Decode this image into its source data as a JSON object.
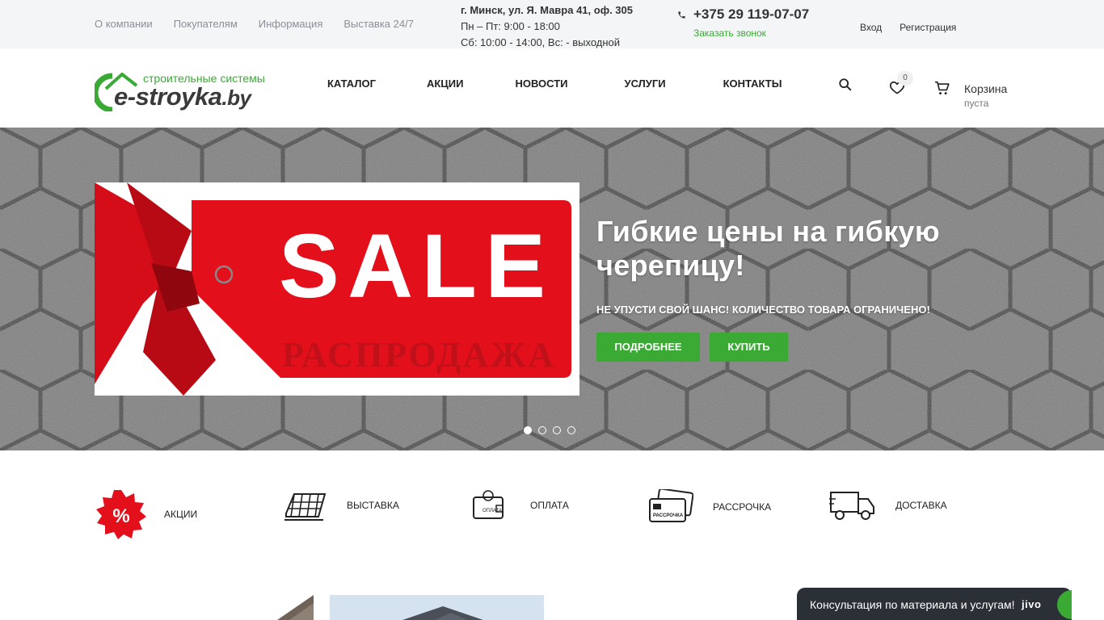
{
  "topbar": {
    "links": [
      "О компании",
      "Покупателям",
      "Информация",
      "Выставка 24/7"
    ],
    "address": "г. Минск, ул. Я. Мавра 41, оф. 305",
    "hours_weekdays": "Пн – Пт: 9:00 - 18:00",
    "hours_weekend": "Сб: 10:00 - 14:00,  Вс: - выходной",
    "phone": "+375 29 119-07-07",
    "callback": "Заказать звонок",
    "login": "Вход",
    "register": "Регистрация"
  },
  "header": {
    "logo_slogan": "строительные системы",
    "logo_brand": "e-stroyka",
    "logo_tld": ".by",
    "nav": [
      "КАТАЛОГ",
      "АКЦИИ",
      "НОВОСТИ",
      "УСЛУГИ",
      "КОНТАКТЫ"
    ],
    "favorites_count": "0",
    "cart_label": "Корзина",
    "cart_status": "пуста"
  },
  "hero": {
    "sale_word": "SALE",
    "sale_ru": "РАСПРОДАЖА",
    "title": "Гибкие цены на гибкую черепицу!",
    "subtitle": "НЕ УПУСТИ СВОЙ ШАНС! КОЛИЧЕСТВО ТОВАРА ОГРАНИЧЕНО!",
    "btn_more": "ПОДРОБНЕЕ",
    "btn_buy": "КУПИТЬ",
    "slide_count": 4,
    "active_slide": 1
  },
  "features": [
    {
      "label": "АКЦИИ",
      "icon": "percent-badge-icon"
    },
    {
      "label": "ВЫСТАВКА",
      "icon": "roof-tiles-icon"
    },
    {
      "label": "ОПЛАТА",
      "icon": "wallet-icon"
    },
    {
      "label": "РАССРОЧКА",
      "icon": "credit-cards-icon"
    },
    {
      "label": "ДОСТАВКА",
      "icon": "delivery-truck-icon"
    }
  ],
  "feature_icon_texts": {
    "percent": "%",
    "wallet": "ОПЛАТА",
    "cards": "РАССРОЧКА"
  },
  "chat": {
    "text": "Консультация по материала и услугам!",
    "brand": "jivo"
  },
  "colors": {
    "accent_green": "#3aaa35",
    "sale_red": "#e3101b",
    "topbar_bg": "#f4f5f7",
    "chat_bg": "#2b2f36"
  }
}
